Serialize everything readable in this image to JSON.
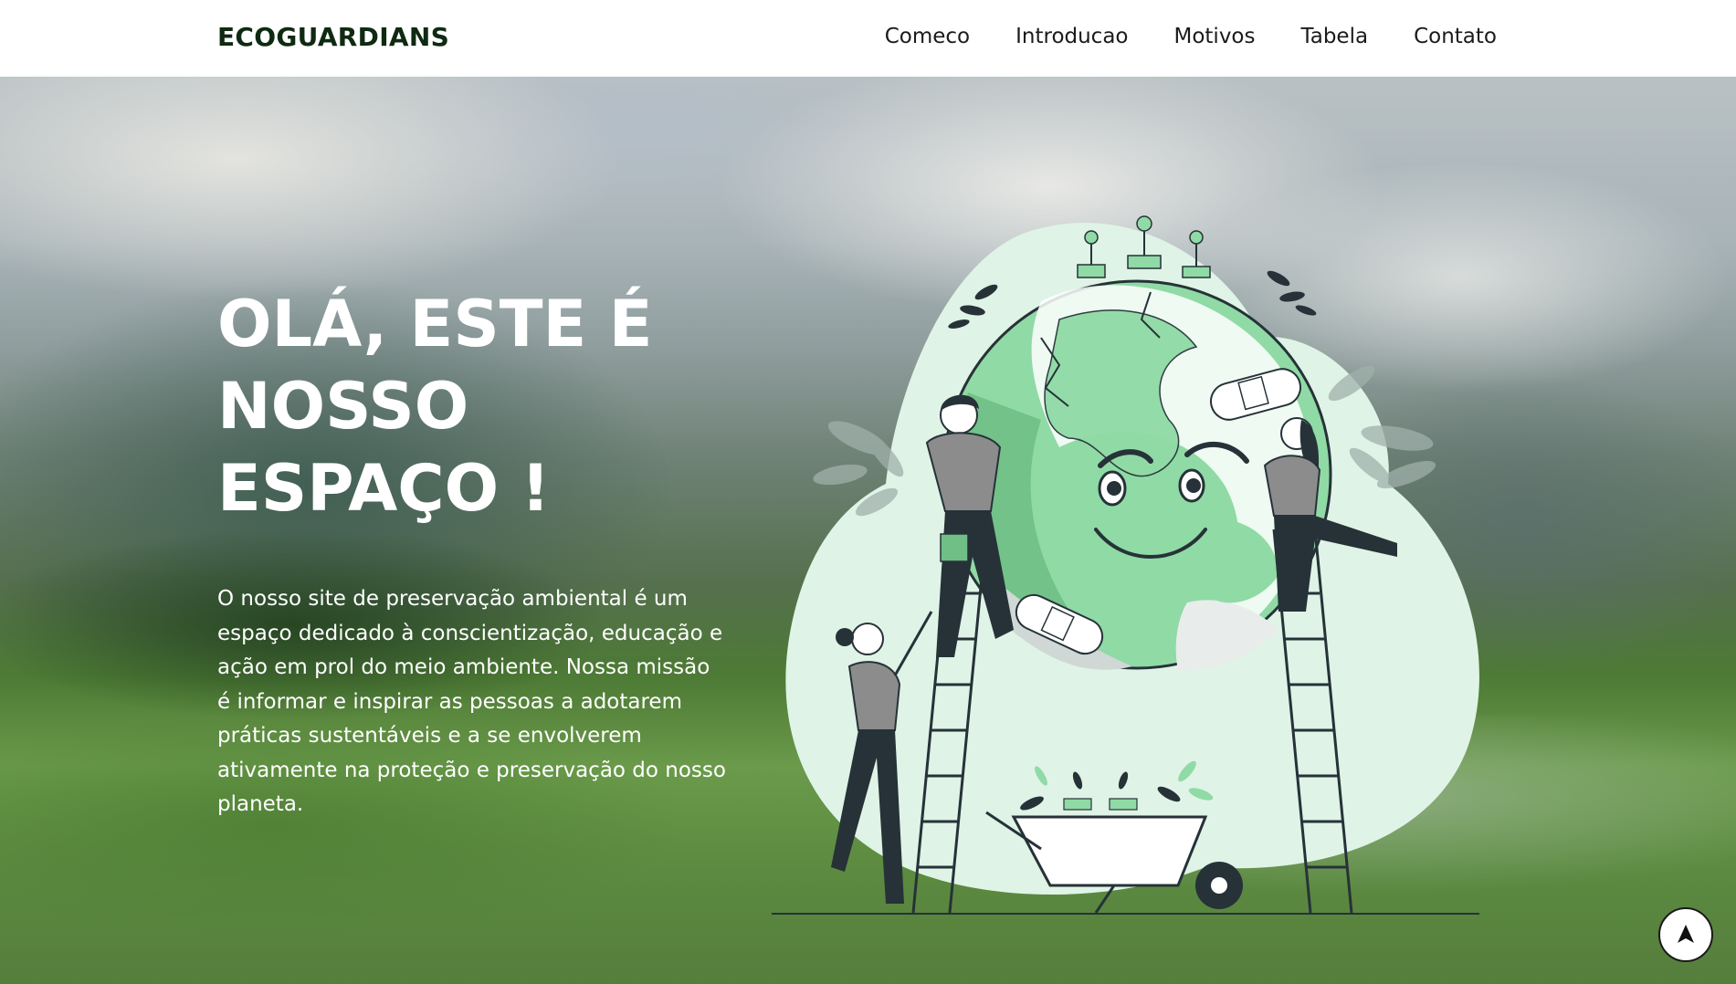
{
  "header": {
    "brand": "ECOGUARDIANS",
    "nav": [
      "Comeco",
      "Introducao",
      "Motivos",
      "Tabela",
      "Contato"
    ]
  },
  "hero": {
    "title_lines": [
      "OLÁ, ESTE É",
      "NOSSO",
      "ESPAÇO !"
    ],
    "description": "O nosso site de preservação ambiental é um espaço dedicado à conscientização, educação e ação em prol do meio ambiente. Nossa missão é informar e inspirar as pessoas a adotarem práticas sustentáveis e a se envolverem ativamente na proteção e preservação do nosso planeta."
  },
  "illustration": {
    "subject": "people-repairing-earth-illustration"
  },
  "back_to_top": {
    "icon": "arrow-up-icon"
  },
  "colors": {
    "accent_green": "#8fdaa5",
    "light_green": "#dff3e6",
    "dark": "#263238",
    "brand_text": "#0f2a12"
  }
}
